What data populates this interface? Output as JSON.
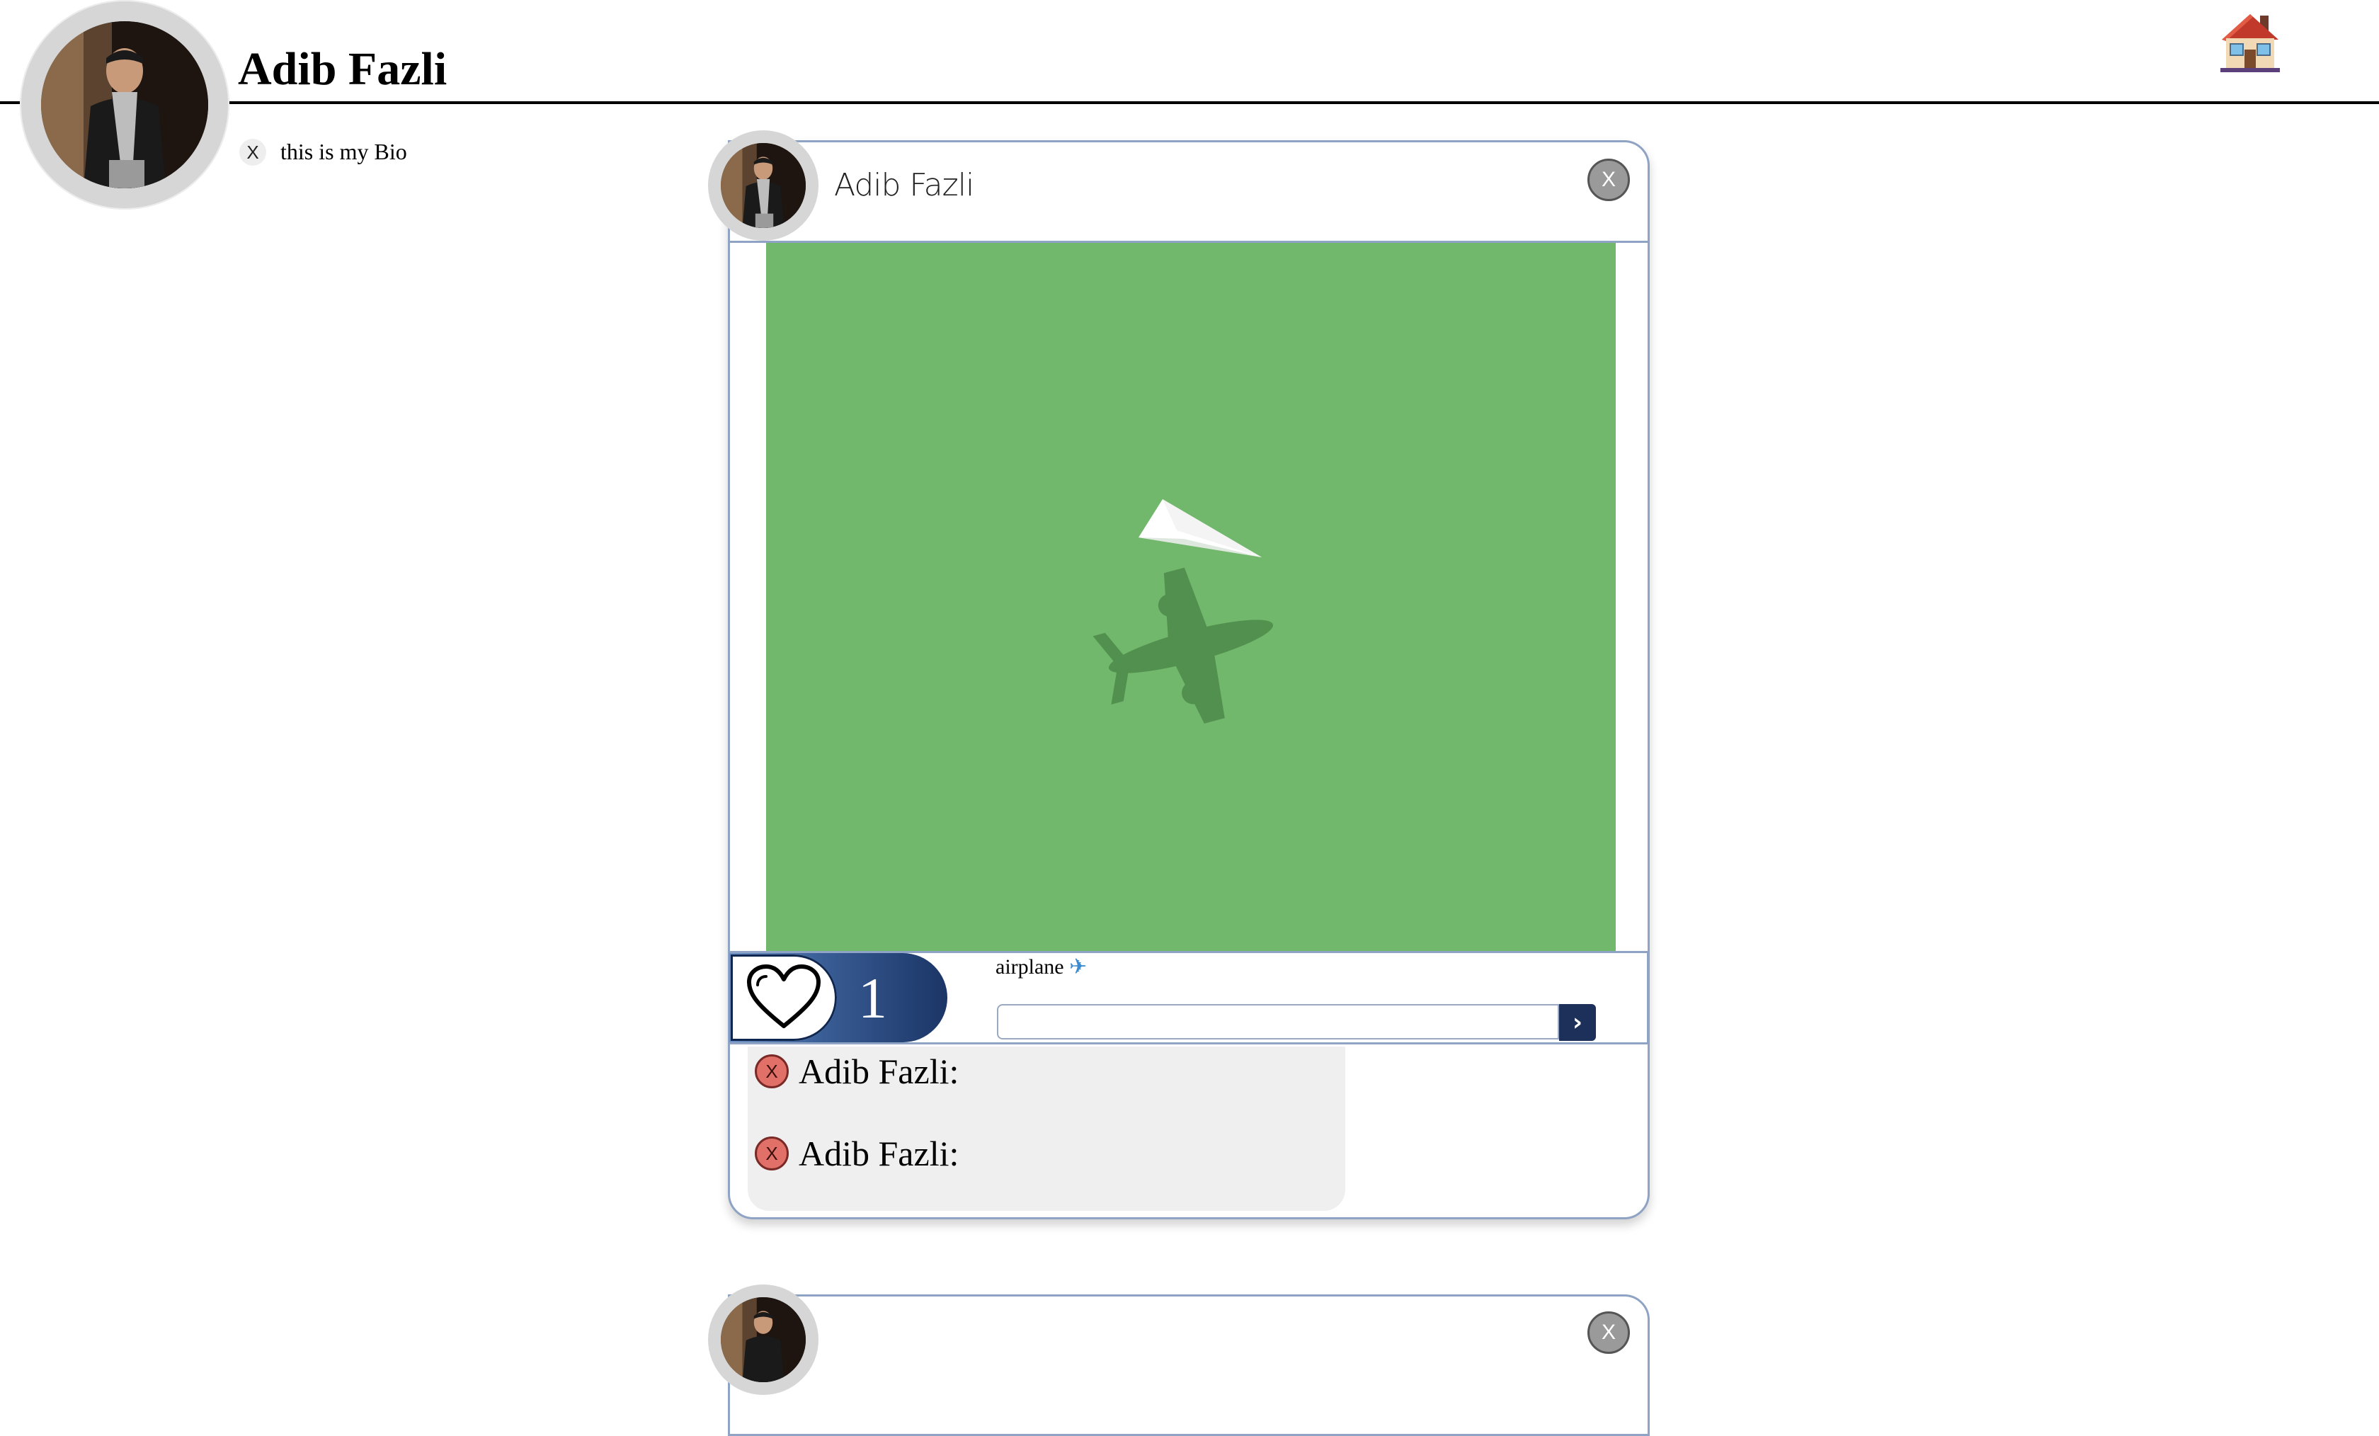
{
  "profile": {
    "name": "Adib Fazli",
    "bio": "this is my Bio",
    "bio_delete_label": "X"
  },
  "nav": {
    "home_icon": "house-icon"
  },
  "post": {
    "author": "Adib Fazli",
    "close_label": "X",
    "image_icon": "paper-plane-with-airplane-shadow",
    "image_color": "#71b86c",
    "likes": "1",
    "caption": "airplane",
    "caption_emoji": "✈",
    "comment_input_value": "",
    "submit_label": "›",
    "comments": [
      {
        "delete_label": "X",
        "author": "Adib Fazli:"
      },
      {
        "delete_label": "X",
        "author": "Adib Fazli:"
      }
    ]
  },
  "next_post": {
    "close_label": "X"
  },
  "colors": {
    "accent": "#1c3059",
    "card_border": "#8fa3c4",
    "delete": "#e07068"
  }
}
